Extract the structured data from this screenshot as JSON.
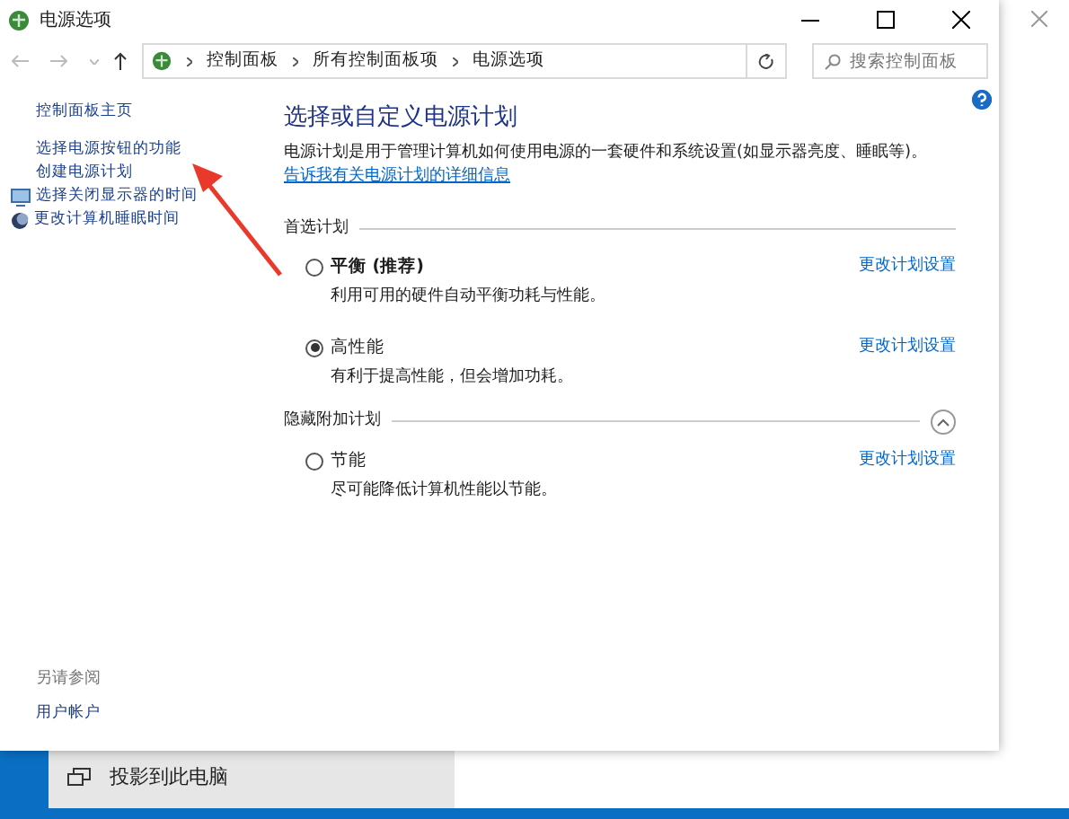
{
  "window": {
    "title": "电源选项"
  },
  "address_bar": {
    "crumbs": [
      "控制面板",
      "所有控制面板项",
      "电源选项"
    ],
    "search_placeholder": "搜索控制面板"
  },
  "sidebar": {
    "items": [
      {
        "label": "控制面板主页",
        "kind": "plain"
      },
      {
        "label": "选择电源按钮的功能",
        "kind": "plain"
      },
      {
        "label": "创建电源计划",
        "kind": "plain"
      },
      {
        "label": "选择关闭显示器的时间",
        "kind": "monitor"
      },
      {
        "label": "更改计算机睡眠时间",
        "kind": "moon"
      }
    ],
    "see_also_title": "另请参阅",
    "see_also": [
      "用户帐户"
    ]
  },
  "main": {
    "heading": "选择或自定义电源计划",
    "description": "电源计划是用于管理计算机如何使用电源的一套硬件和系统设置(如显示器亮度、睡眠等)。",
    "description_link": "告诉我有关电源计划的详细信息",
    "groups": [
      {
        "title": "首选计划",
        "collapse_button": false,
        "plans": [
          {
            "name": "平衡 (推荐)",
            "bold": true,
            "selected": false,
            "description": "利用可用的硬件自动平衡功耗与性能。",
            "link": "更改计划设置"
          },
          {
            "name": "高性能",
            "bold": false,
            "selected": true,
            "description": "有利于提高性能，但会增加功耗。",
            "link": "更改计划设置"
          }
        ]
      },
      {
        "title": "隐藏附加计划",
        "collapse_button": true,
        "plans": [
          {
            "name": "节能",
            "bold": false,
            "selected": false,
            "description": "尽可能降低计算机性能以节能。",
            "link": "更改计划设置"
          }
        ]
      }
    ]
  },
  "background_window": {
    "menu_item": "投影到此电脑"
  }
}
